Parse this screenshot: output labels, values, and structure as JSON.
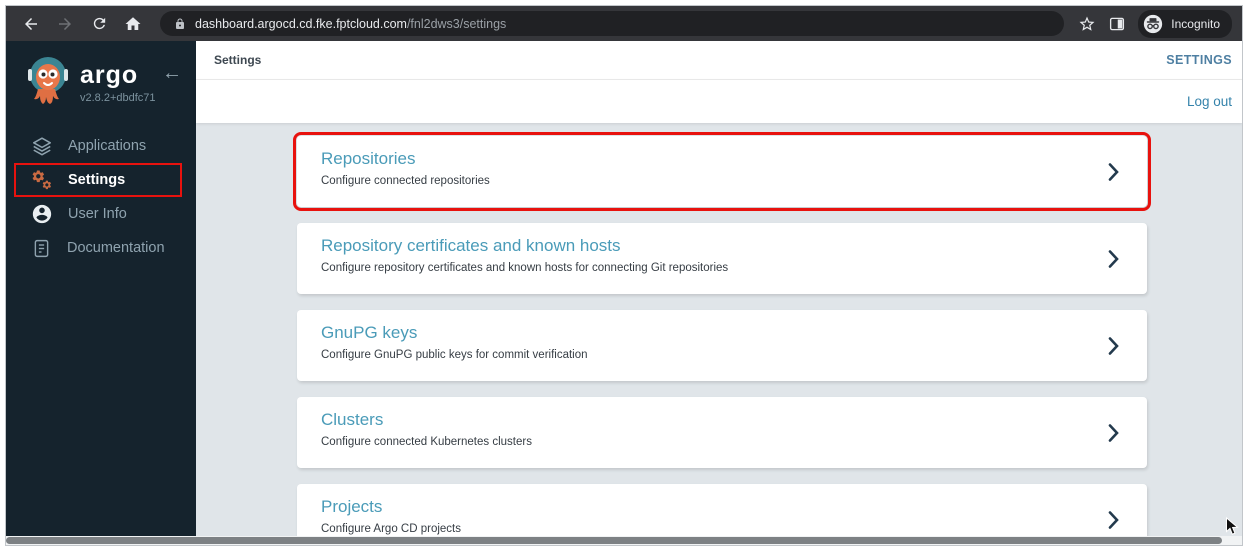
{
  "browser": {
    "url": {
      "domain": "dashboard.argocd.cd.fke.fptcloud.com",
      "path": "/fnl2dws3/settings"
    },
    "incognito_label": "Incognito"
  },
  "sidebar": {
    "logo_text": "argo",
    "version": "v2.8.2+dbdfc71",
    "items": [
      {
        "label": "Applications",
        "icon": "layers-icon",
        "active": false
      },
      {
        "label": "Settings",
        "icon": "gears-icon",
        "active": true,
        "annotated": true
      },
      {
        "label": "User Info",
        "icon": "user-circle-icon",
        "active": false
      },
      {
        "label": "Documentation",
        "icon": "journal-icon",
        "active": false
      }
    ]
  },
  "topbar": {
    "breadcrumb": "Settings",
    "page_label": "SETTINGS",
    "logout_label": "Log out"
  },
  "cards": [
    {
      "title": "Repositories",
      "description": "Configure connected repositories",
      "annotated": true
    },
    {
      "title": "Repository certificates and known hosts",
      "description": "Configure repository certificates and known hosts for connecting Git repositories",
      "annotated": false
    },
    {
      "title": "GnuPG keys",
      "description": "Configure GnuPG public keys for commit verification",
      "annotated": false
    },
    {
      "title": "Clusters",
      "description": "Configure connected Kubernetes clusters",
      "annotated": false
    },
    {
      "title": "Projects",
      "description": "Configure Argo CD projects",
      "annotated": false
    }
  ],
  "colors": {
    "sidebar_bg": "#15232d",
    "card_title_teal": "#4a9bb8",
    "annotation_red": "#e8120e",
    "settings_label_blue": "#4e7fa2",
    "logout_blue": "#3583ab",
    "active_gear_orange": "#c96a42",
    "chrome_bar": "#35363a",
    "content_bg": "#e0e5e9"
  }
}
